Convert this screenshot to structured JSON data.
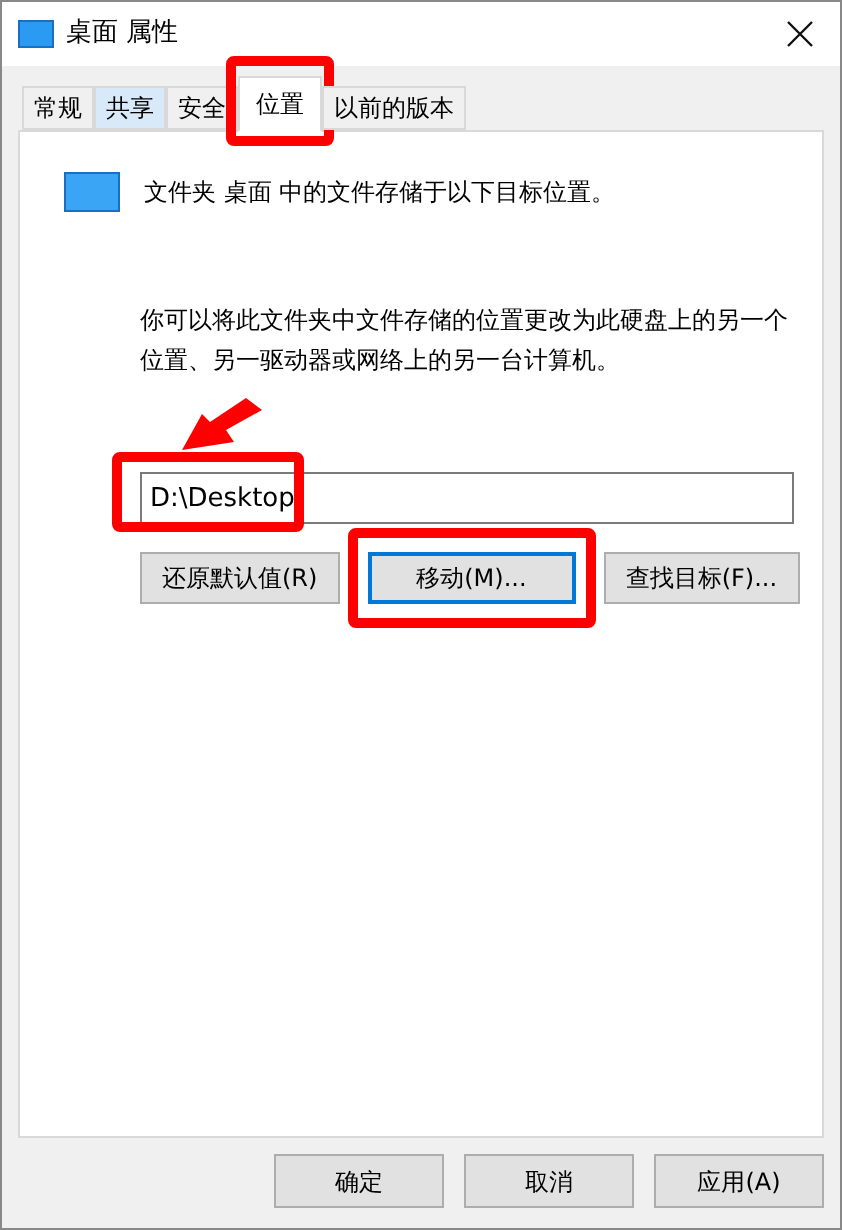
{
  "window": {
    "title": "桌面 属性"
  },
  "tabs": [
    {
      "label": "常规",
      "selected": false,
      "hovered": false,
      "highlighted": false
    },
    {
      "label": "共享",
      "selected": false,
      "hovered": true,
      "highlighted": false
    },
    {
      "label": "安全",
      "selected": false,
      "hovered": false,
      "highlighted": false
    },
    {
      "label": "位置",
      "selected": true,
      "hovered": false,
      "highlighted": true
    },
    {
      "label": "以前的版本",
      "selected": false,
      "hovered": false,
      "highlighted": false
    }
  ],
  "info": "文件夹 桌面 中的文件存储于以下目标位置。",
  "description": "你可以将此文件夹中文件存储的位置更改为此硬盘上的另一个位置、另一驱动器或网络上的另一台计算机。",
  "path": {
    "value": "D:\\Desktop",
    "highlighted": true
  },
  "actions": [
    {
      "label": "还原默认值(R)",
      "focused": false,
      "highlighted": false
    },
    {
      "label": "移动(M)...",
      "focused": true,
      "highlighted": true
    },
    {
      "label": "查找目标(F)...",
      "focused": false,
      "highlighted": false
    }
  ],
  "buttons": [
    {
      "label": "确定"
    },
    {
      "label": "取消"
    },
    {
      "label": "应用(A)"
    }
  ]
}
